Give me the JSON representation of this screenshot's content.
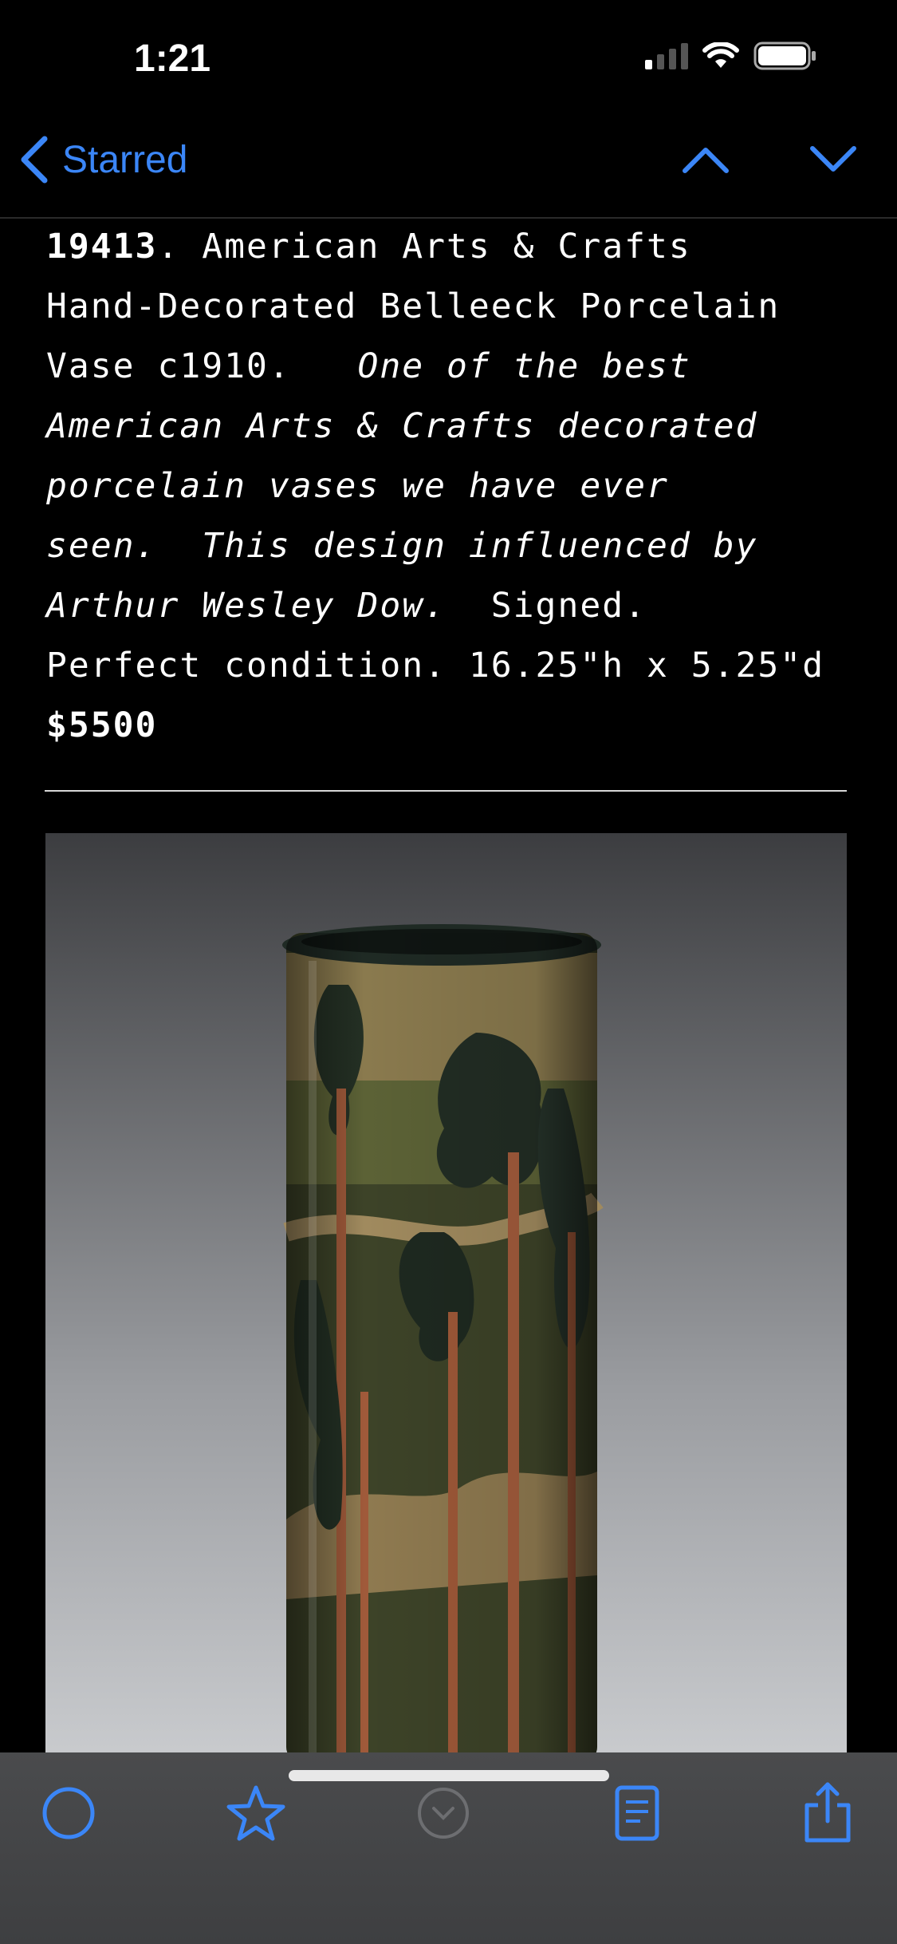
{
  "status_bar": {
    "time": "1:21"
  },
  "nav": {
    "back_label": "Starred"
  },
  "listing": {
    "number": "19413",
    "title_after_number": ". American Arts & Crafts\nHand-Decorated Belleeck Porcelain\nVase c1910.   ",
    "italic_text": "One of the best\nAmerican Arts & Crafts decorated\nporcelain vases we have ever\nseen.  This design influenced by\nArthur Wesley Dow.",
    "plain_after_italic": "  Signed.\nPerfect condition. 16.25\"h x 5.25\"d\n",
    "price": "$5500"
  },
  "photo": {
    "subject": "vase-photo"
  },
  "colors": {
    "accent": "#3b86f7",
    "background": "#000000",
    "toolbar": "#444547"
  },
  "toolbar": {
    "icons": [
      "circle-icon",
      "star-icon",
      "chevron-down-circle-icon",
      "document-icon",
      "share-icon"
    ]
  }
}
